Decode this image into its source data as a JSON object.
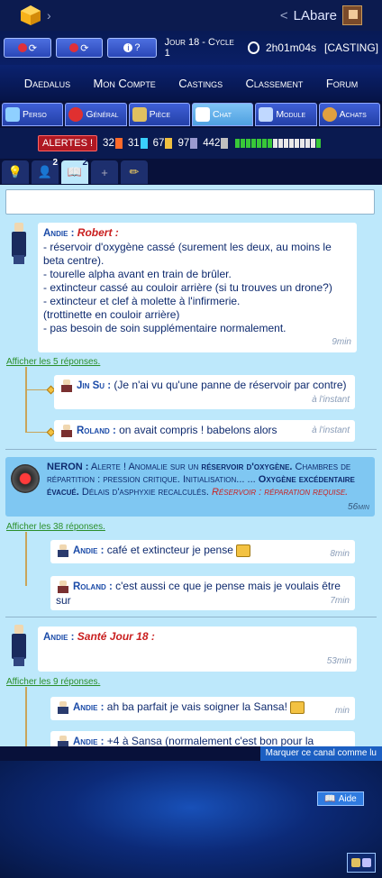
{
  "topbar": {
    "user_name": "LAbare",
    "back_glyph": "<"
  },
  "gamebar": {
    "cycle_label": "Jour 18 - Cycle 1",
    "timer": "2h01m04s",
    "status": "[CASTING]",
    "help_btn": "?"
  },
  "mainmenu": [
    "Daedalus",
    "Mon Compte",
    "Castings",
    "Classement",
    "Forum"
  ],
  "tabs": [
    "Perso",
    "Général",
    "Pièce",
    "Chat",
    "Module",
    "Achats"
  ],
  "stats": {
    "alerts_label": "ALERTES !",
    "oxygen": "32",
    "fuel": "31",
    "hull": "67",
    "shield": "97",
    "extra": "442"
  },
  "channel_tabs": {
    "badge1": "2",
    "badge2": "2",
    "add": "+"
  },
  "messages": {
    "m1": {
      "author": "Andie :",
      "title": "Robert :",
      "lines": [
        "- réservoir d'oxygène cassé (surement les deux, au moins le beta centre).",
        "- tourelle alpha avant en train de brûler.",
        "- extincteur cassé au couloir arrière (si tu trouves un drone?)",
        "- extincteur et clef à molette à l'infirmerie.",
        "(trottinette en couloir arrière)",
        "- pas besoin de soin supplémentaire normalement."
      ],
      "time": "9min",
      "show_replies": "Afficher les 5 réponses.",
      "r1_author": "Jin Su :",
      "r1_text": "(Je n'ai vu qu'une panne de réservoir par contre)",
      "r1_time": "à l'instant",
      "r2_author": "Roland :",
      "r2_text": "on avait compris ! babelons alors",
      "r2_time": "à l'instant"
    },
    "neron": {
      "author": "NERON :",
      "t1": "Alerte ! Anomalie sur un",
      "t2": "réservoir d'oxygène.",
      "t3": "Chambres de répartition : pression critique. Initialisation... ...",
      "t4": "Oxygène excédentaire évacué.",
      "t5": "Délais d'asphyxie recalculés.",
      "t6": "Réservoir : réparation requise.",
      "time": "56min",
      "show_replies": "Afficher les 38 réponses.",
      "r1_author": "Andie :",
      "r1_text": "café et extincteur je pense",
      "r1_time": "8min",
      "r2_author": "Roland :",
      "r2_text": "c'est aussi ce que je pense mais je voulais être sur",
      "r2_time": "7min"
    },
    "m3": {
      "author": "Andie :",
      "title": "Santé Jour 18 :",
      "time": "53min",
      "show_replies": "Afficher les 9 réponses.",
      "r1_author": "Andie :",
      "r1_text": "ah ba parfait je vais soigner la Sansa!",
      "r1_time": "min",
      "r2_author": "Andie :",
      "r2_text": "+4 à Sansa (normalement c'est bon pour la"
    }
  },
  "mark_read": "Marquer ce canal comme lu",
  "help": "Aide"
}
